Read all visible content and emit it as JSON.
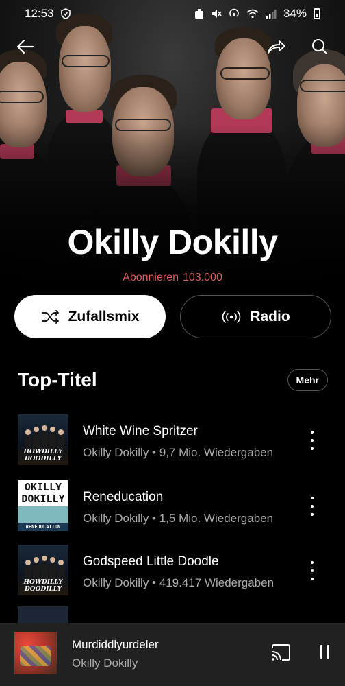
{
  "status_bar": {
    "time": "12:53",
    "battery": "34%"
  },
  "top_bar": {
    "back_icon": "arrow-left-icon",
    "share_icon": "share-arrow-icon",
    "search_icon": "search-icon"
  },
  "artist": {
    "name": "Okilly Dokilly",
    "subscribe_label": "Abonnieren",
    "subscriber_count": "103.000"
  },
  "actions": {
    "shuffle_label": "Zufallsmix",
    "radio_label": "Radio"
  },
  "top_tracks": {
    "heading": "Top-Titel",
    "more_label": "Mehr",
    "items": [
      {
        "title": "White Wine Spritzer",
        "meta": "Okilly Dokilly • 9,7 Mio. Wiedergaben",
        "art_text": "HOWDILLY DOODILLY"
      },
      {
        "title": "Reneducation",
        "meta": "Okilly Dokilly • 1,5 Mio. Wiedergaben",
        "art_text_top": "OKILLY DOKILLY",
        "art_text_bottom": "RENEDUCATION"
      },
      {
        "title": "Godspeed Little Doodle",
        "meta": "Okilly Dokilly • 419.417 Wiedergaben",
        "art_text": "HOWDILLY DOODILLY"
      }
    ]
  },
  "now_playing": {
    "title": "Murdiddlyurdeler",
    "artist": "Okilly Dokilly",
    "cast_icon": "cast-icon",
    "pause_icon": "pause-icon"
  },
  "colors": {
    "accent_red": "#e05a5a",
    "background": "#000000",
    "mini_player_bg": "#212121",
    "collar_pink": "#b33a57"
  }
}
